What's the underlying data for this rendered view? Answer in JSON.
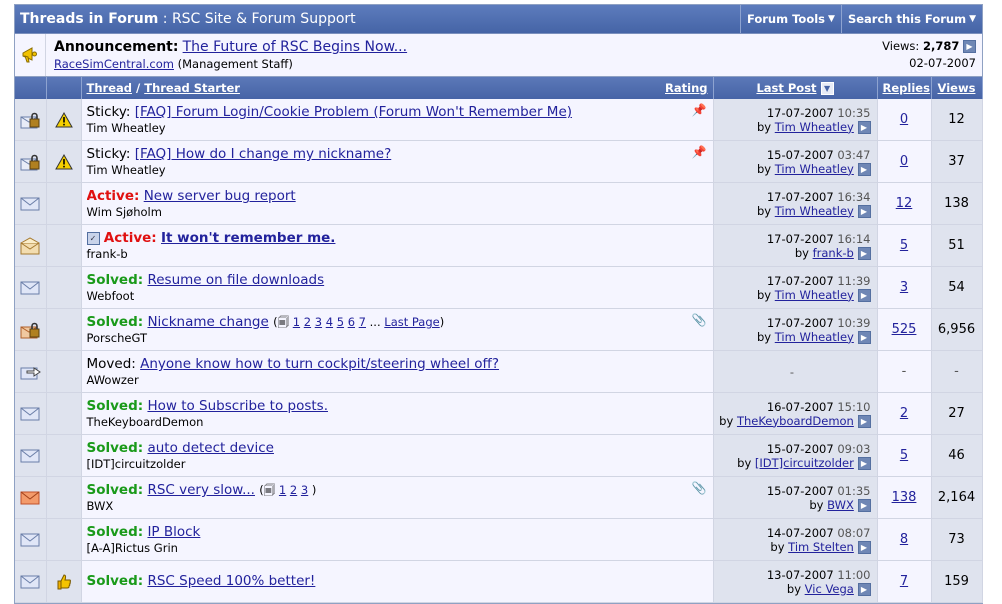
{
  "header": {
    "label": "Threads in Forum",
    "separator": ":",
    "forum_name": "RSC Site & Forum Support",
    "menu_forum_tools": "Forum Tools",
    "menu_search": "Search this Forum"
  },
  "announcement": {
    "label": "Announcement:",
    "title": "The Future of RSC Begins Now...",
    "author": "RaceSimCentral.com",
    "author_role": "(Management Staff)",
    "views_label": "Views:",
    "views": "2,787",
    "date": "02-07-2007"
  },
  "columns": {
    "thread": "Thread",
    "slash": "/",
    "thread_starter": "Thread Starter",
    "rating": "Rating",
    "last_post": "Last Post",
    "replies": "Replies",
    "views": "Views"
  },
  "threads": [
    {
      "status_icon": "locked-icon",
      "topic_icon": "warning-icon",
      "prefix": "Sticky:",
      "prefix_type": "sticky",
      "title": "[FAQ] Forum Login/Cookie Problem (Forum Won't Remember Me)",
      "starter": "Tim Wheatley",
      "date": "17-07-2007",
      "time": "10:35",
      "by": "by",
      "last_poster": "Tim Wheatley",
      "replies": "0",
      "views": "12",
      "pinned": true
    },
    {
      "status_icon": "locked-icon",
      "topic_icon": "warning-icon",
      "prefix": "Sticky:",
      "prefix_type": "sticky",
      "title": "[FAQ] How do I change my nickname?",
      "starter": "Tim Wheatley",
      "date": "15-07-2007",
      "time": "03:47",
      "by": "by",
      "last_poster": "Tim Wheatley",
      "replies": "0",
      "views": "37",
      "pinned": true
    },
    {
      "status_icon": "envelope-icon",
      "prefix": "Active:",
      "prefix_type": "active",
      "title": "New server bug report",
      "starter": "Wim Sjøholm",
      "date": "17-07-2007",
      "time": "16:34",
      "by": "by",
      "last_poster": "Tim Wheatley",
      "replies": "12",
      "views": "138"
    },
    {
      "status_icon": "envelope-open-icon",
      "checkbox": true,
      "prefix": "Active:",
      "prefix_type": "active",
      "title": "It won't remember me.",
      "title_bold": true,
      "starter": "frank-b",
      "date": "17-07-2007",
      "time": "16:14",
      "by": "by",
      "last_poster": "frank-b",
      "replies": "5",
      "views": "51"
    },
    {
      "status_icon": "envelope-icon",
      "prefix": "Solved:",
      "prefix_type": "solved",
      "title": "Resume on file downloads",
      "starter": "Webfoot",
      "date": "17-07-2007",
      "time": "11:39",
      "by": "by",
      "last_poster": "Tim Wheatley",
      "replies": "3",
      "views": "54"
    },
    {
      "status_icon": "locked-hot-icon",
      "prefix": "Solved:",
      "prefix_type": "solved",
      "title": "Nickname change",
      "pages_open": "(",
      "pages": [
        "1",
        "2",
        "3",
        "4",
        "5",
        "6",
        "7"
      ],
      "pages_ellipsis": "...",
      "last_page": "Last Page",
      "pages_close": ")",
      "starter": "PorscheGT",
      "date": "17-07-2007",
      "time": "10:39",
      "by": "by",
      "last_poster": "Tim Wheatley",
      "replies": "525",
      "views": "6,956",
      "attachment": true
    },
    {
      "status_icon": "moved-icon",
      "prefix": "Moved:",
      "prefix_type": "moved",
      "title": "Anyone know how to turn cockpit/steering wheel off?",
      "starter": "AWowzer",
      "moved": true,
      "dash": "-"
    },
    {
      "status_icon": "envelope-icon",
      "prefix": "Solved:",
      "prefix_type": "solved",
      "title": "How to Subscribe to posts.",
      "starter": "TheKeyboardDemon",
      "date": "16-07-2007",
      "time": "15:10",
      "by": "by",
      "last_poster": "TheKeyboardDemon",
      "replies": "2",
      "views": "27"
    },
    {
      "status_icon": "envelope-icon",
      "prefix": "Solved:",
      "prefix_type": "solved",
      "title": "auto detect device",
      "starter": "[IDT]circuitzolder",
      "date": "15-07-2007",
      "time": "09:03",
      "by": "by",
      "last_poster": "[IDT]circuitzolder",
      "replies": "5",
      "views": "46"
    },
    {
      "status_icon": "envelope-hot-icon",
      "prefix": "Solved:",
      "prefix_type": "solved",
      "title": "RSC very slow...",
      "pages_open": "(",
      "pages": [
        "1",
        "2",
        "3"
      ],
      "pages_close": ")",
      "starter": "BWX",
      "date": "15-07-2007",
      "time": "01:35",
      "by": "by",
      "last_poster": "BWX",
      "replies": "138",
      "views": "2,164",
      "attachment": true
    },
    {
      "status_icon": "envelope-icon",
      "prefix": "Solved:",
      "prefix_type": "solved",
      "title": "IP Block",
      "starter": "[A-A]Rictus Grin",
      "date": "14-07-2007",
      "time": "08:07",
      "by": "by",
      "last_poster": "Tim Stelten",
      "replies": "8",
      "views": "73"
    },
    {
      "status_icon": "envelope-icon",
      "topic_icon": "thumbs-up-icon",
      "prefix": "Solved:",
      "prefix_type": "solved",
      "title": "RSC Speed 100% better!",
      "starter": "",
      "date": "13-07-2007",
      "time": "11:00",
      "by": "by",
      "last_poster": "Vic Vega",
      "replies": "7",
      "views": "159"
    }
  ]
}
